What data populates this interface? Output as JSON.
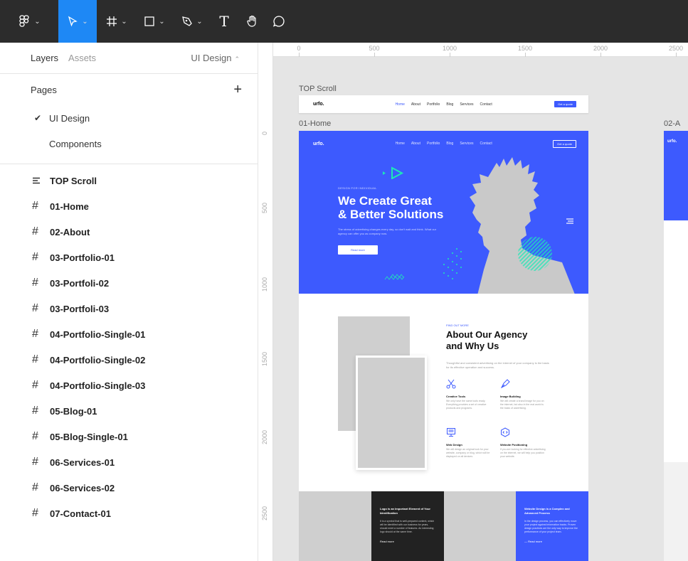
{
  "toolbar": {
    "tools": [
      {
        "name": "main-menu",
        "icon": "figma-logo-icon"
      },
      {
        "name": "move",
        "icon": "cursor-icon"
      },
      {
        "name": "frame",
        "icon": "frame-icon"
      },
      {
        "name": "shape",
        "icon": "rectangle-icon"
      },
      {
        "name": "pen",
        "icon": "pen-icon"
      },
      {
        "name": "text",
        "icon": "text-icon"
      },
      {
        "name": "hand",
        "icon": "hand-icon"
      },
      {
        "name": "comment",
        "icon": "comment-icon"
      }
    ],
    "text_glyph": "T"
  },
  "sidebar": {
    "tabs": {
      "layers": "Layers",
      "assets": "Assets"
    },
    "current_page_switch": "UI Design",
    "pages_label": "Pages",
    "add_page_glyph": "+",
    "pages": [
      {
        "label": "UI Design",
        "current": true
      },
      {
        "label": "Components",
        "current": false
      }
    ],
    "layers": [
      {
        "label": "TOP Scroll",
        "icon": "horizontal-layout-icon"
      },
      {
        "label": "01-Home",
        "icon": "frame-icon"
      },
      {
        "label": "02-About",
        "icon": "frame-icon"
      },
      {
        "label": "03-Portfolio-01",
        "icon": "frame-icon"
      },
      {
        "label": "03-Portfoli-02",
        "icon": "frame-icon"
      },
      {
        "label": "03-Portfoli-03",
        "icon": "frame-icon"
      },
      {
        "label": "04-Portfolio-Single-01",
        "icon": "frame-icon"
      },
      {
        "label": "04-Portfolio-Single-02",
        "icon": "frame-icon"
      },
      {
        "label": "04-Portfolio-Single-03",
        "icon": "frame-icon"
      },
      {
        "label": "05-Blog-01",
        "icon": "frame-icon"
      },
      {
        "label": "05-Blog-Single-01",
        "icon": "frame-icon"
      },
      {
        "label": "06-Services-01",
        "icon": "frame-icon"
      },
      {
        "label": "06-Services-02",
        "icon": "frame-icon"
      },
      {
        "label": "07-Contact-01",
        "icon": "frame-icon"
      }
    ]
  },
  "canvas": {
    "ruler_top": [
      "0",
      "500",
      "1000",
      "1500",
      "2000",
      "2500"
    ],
    "ruler_left": [
      "0",
      "500",
      "1000",
      "1500",
      "2000",
      "2500"
    ],
    "frame_labels": {
      "top_scroll": "TOP Scroll",
      "home": "01-Home",
      "about": "02-A"
    },
    "site": {
      "logo": "urfo.",
      "nav": [
        "Home",
        "About",
        "Portfolio",
        "Blog",
        "Services",
        "Contact"
      ],
      "cta": "Get a quote",
      "hero_kicker": "DESIGN FOR INDIVIDUAL",
      "hero_title_1": "We Create Great",
      "hero_title_2": "& Better Solutions",
      "hero_text": "The stress of advertising changes every day, so don't wait and think. What our agency can offer you as company now.",
      "hero_button": "Read more",
      "about_kicker": "FIND OUT MORE",
      "about_title_1": "About Our Agency",
      "about_title_2": "and Why Us",
      "about_text": "Thoughtful and consistent advertising on the internet of your company is the basis for its effective operation and success.",
      "features": [
        {
          "title": "Creative Tools",
          "text": "We only have the same tools ready. Everything provides a set of creative products and programs.",
          "icon": "scissors-icon"
        },
        {
          "title": "Image Building",
          "text": "We will create a brand image for you on the internet, but also in the real world is the basis of advertising.",
          "icon": "pen-nib-icon"
        },
        {
          "title": "Web Design",
          "text": "We will design an original look for your website, company or blog, which will be displayed on all devices.",
          "icon": "monitor-icon"
        },
        {
          "title": "Website Positioning",
          "text": "If you are looking for effective advertising on the internet, we will help you position your website.",
          "icon": "code-hexagon-icon"
        }
      ],
      "dark_card": {
        "title": "Logo is an Important Element of Your Identification",
        "text": "It is a symbol that is well-prepared content, which will be identified with our business for years, should meet a number of features. An interesting logo should at the same time.",
        "link": "Read more"
      },
      "blue_card": {
        "title": "Website Design is a Complex and Advanced Process",
        "text": "In the design process, you can effectively move your project against information tracks. Proven design practices are the only way to improve the performance of your project team.",
        "link": "Read more"
      }
    },
    "colors": {
      "accent": "#3d5afe",
      "selection": "#1e88f5",
      "dark": "#222222",
      "teal": "#1de9b6"
    }
  }
}
